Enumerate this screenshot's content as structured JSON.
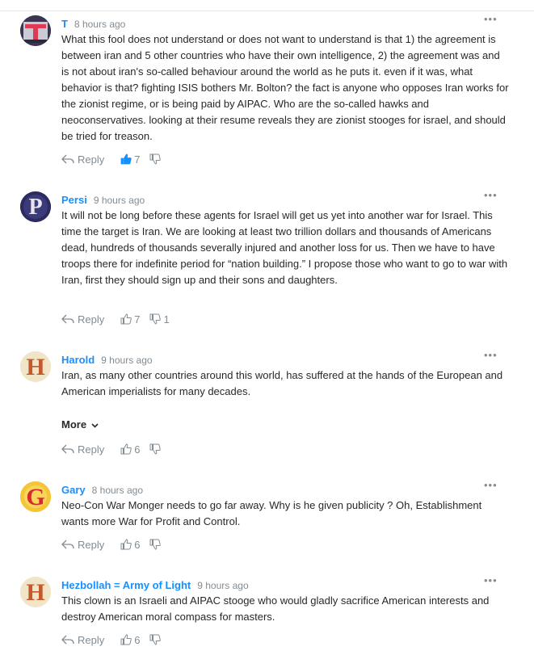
{
  "labels": {
    "reply": "Reply",
    "more": "More"
  },
  "colors": {
    "author": "#188fff",
    "muted": "#828c93",
    "liked": "#188fff"
  },
  "comments": [
    {
      "author": "T",
      "time": "8 hours ago",
      "avatar_icon": "t-letter-avatar-icon",
      "text": "What this fool does not understand or does not want to understand is that 1) the agreement is between iran and 5 other countries who have their own intelligence, 2) the agreement was and is not about iran's so-called behaviour around the world as he puts it. even if it was, what behavior is that? fighting ISIS bothers Mr. Bolton? the fact is anyone who opposes Iran works for the zionist regime, or is being paid by AIPAC. Who are the so-called hawks and neoconservatives. looking at their resume reveals they are zionist stooges for israel, and should be tried for treason.",
      "likes": "7",
      "dislikes": "",
      "liked": true
    },
    {
      "author": "Persi",
      "time": "9 hours ago",
      "avatar_icon": "p-letter-avatar-icon",
      "text": "It will not be long before these agents for Israel will get us yet into another war for Israel. This time the target is Iran. We are looking at least two trillion dollars and thousands of Americans dead, hundreds of thousands severally injured and another loss for us. Then we have to have troops there for indefinite period for “nation building.” I propose those who want to go to war with Iran, first they should sign up and their sons and daughters.",
      "likes": "7",
      "dislikes": "1",
      "liked": false
    },
    {
      "author": "Harold",
      "time": "9 hours ago",
      "avatar_icon": "h-letter-avatar-icon",
      "text": "Iran, as many other countries around this world, has suffered at the hands of the European and American imperialists for many decades.",
      "likes": "6",
      "dislikes": "",
      "liked": false,
      "more": true
    },
    {
      "author": "Gary",
      "time": "8 hours ago",
      "avatar_icon": "g-letter-avatar-icon",
      "text": "Neo-Con War Monger needs to go far away. Why is he given publicity ? Oh, Establishment wants more War for Profit and Control.",
      "likes": "6",
      "dislikes": "",
      "liked": false
    },
    {
      "author": "Hezbollah = Army of Light",
      "time": "9 hours ago",
      "avatar_icon": "h-letter-avatar-icon",
      "text": "This clown is an Israeli and AIPAC stooge who would gladly sacrifice American interests and destroy American moral compass for masters.",
      "likes": "6",
      "dislikes": "",
      "liked": false
    }
  ]
}
